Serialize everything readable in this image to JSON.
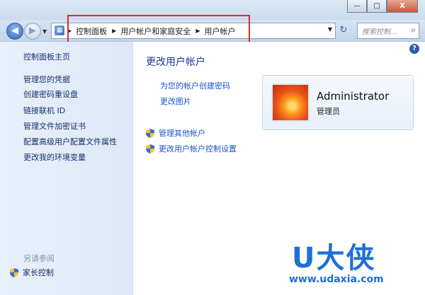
{
  "window": {
    "controls": {
      "minimize": "—",
      "maximize": "□",
      "close": "X"
    }
  },
  "address_bar": {
    "breadcrumbs": [
      "控制面板",
      "用户帐户和家庭安全",
      "用户帐户"
    ],
    "search_placeholder": "搜索控制...",
    "icons": [
      "back-icon",
      "forward-icon",
      "control-panel-icon",
      "refresh-icon",
      "search-icon"
    ]
  },
  "sidebar": {
    "items": [
      {
        "label": "控制面板主页"
      },
      {
        "label": "管理您的凭据"
      },
      {
        "label": "创建密码重设盘"
      },
      {
        "label": "链接联机 ID"
      },
      {
        "label": "管理文件加密证书"
      },
      {
        "label": "配置高级用户配置文件属性"
      },
      {
        "label": "更改我的环境变量"
      }
    ],
    "see_also_title": "另请参阅",
    "see_also_items": [
      {
        "label": "家长控制",
        "icon": "shield-icon"
      }
    ]
  },
  "main": {
    "help": "?",
    "heading": "更改用户帐户",
    "links": [
      {
        "label": "为您的帐户创建密码"
      },
      {
        "label": "更改图片"
      }
    ],
    "shield_links": [
      {
        "label": "管理其他帐户",
        "icon": "shield-icon"
      },
      {
        "label": "更改用户帐户控制设置",
        "icon": "shield-icon"
      }
    ],
    "user": {
      "name": "Administrator",
      "role": "管理员"
    }
  },
  "watermark": {
    "logo": "U大侠",
    "url": "www.udaxia.com"
  },
  "colors": {
    "highlight_box": "#e22b2b",
    "link": "#1c56c7",
    "heading": "#1c3b8f",
    "watermark": "#1d70d6"
  }
}
